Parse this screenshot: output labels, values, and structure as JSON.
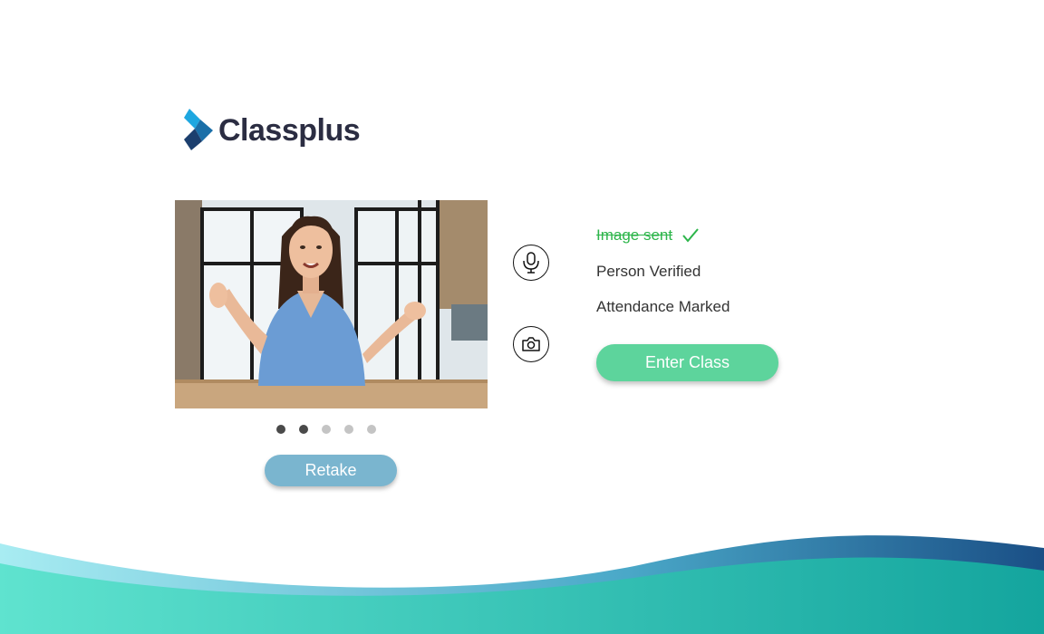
{
  "brand": {
    "name": "Classplus",
    "logo_icon": "classplus-logo-icon",
    "text_color": "#2b2d42"
  },
  "video": {
    "thumbnail_icon": "person-video-frame"
  },
  "carousel": {
    "total": 5,
    "active": [
      0,
      1
    ]
  },
  "actions": {
    "retake_label": "Retake",
    "enter_class_label": "Enter Class",
    "mic_icon": "microphone-icon",
    "camera_icon": "camera-icon"
  },
  "status": {
    "image_sent": "Image sent",
    "person_verified": "Person Verified",
    "attendance_marked": "Attendance Marked"
  },
  "colors": {
    "retake": "#7ab5cf",
    "enter_class": "#5dd49c",
    "success": "#2cb54a",
    "wave_start": "#5fe3cf",
    "wave_end": "#1a4f86"
  }
}
